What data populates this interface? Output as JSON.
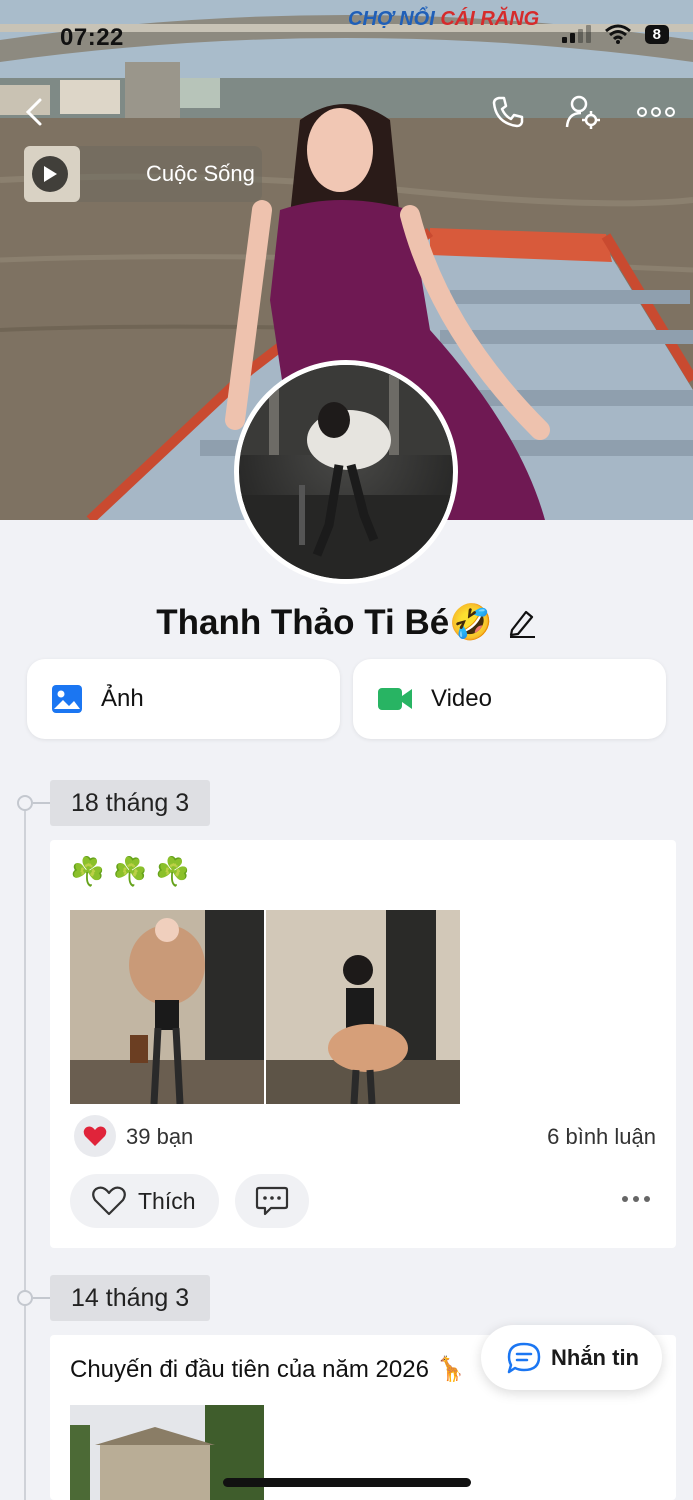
{
  "status_bar": {
    "time": "07:22",
    "battery": "8"
  },
  "cover": {
    "sign_part1": "CHỢ NỔI",
    "sign_part2": "CÁI RĂNG",
    "music_title": "Cuộc Sống",
    "back_icon": "chevron-left-icon",
    "call_icon": "phone-icon",
    "settings_icon": "user-settings-icon",
    "more_icon": "more-horizontal-icon"
  },
  "profile": {
    "name": "Thanh Thảo Ti Bé🤣",
    "edit_icon": "pencil-icon"
  },
  "media": {
    "photos_label": "Ảnh",
    "videos_label": "Video",
    "photos_color": "#1b76f2",
    "videos_color": "#28b463"
  },
  "timeline": [
    {
      "date": "18 tháng 3",
      "text": "☘️ ☘️ ☘️",
      "reactions": "39 bạn",
      "comments": "6 bình luận",
      "like_label": "Thích"
    },
    {
      "date": "14 tháng 3",
      "text": "Chuyến đi đầu tiên của năm 2026 🦒"
    }
  ],
  "chat_button": {
    "label": "Nhắn tin"
  },
  "colors": {
    "accent": "#1b76f2",
    "heart": "#e0243a"
  }
}
